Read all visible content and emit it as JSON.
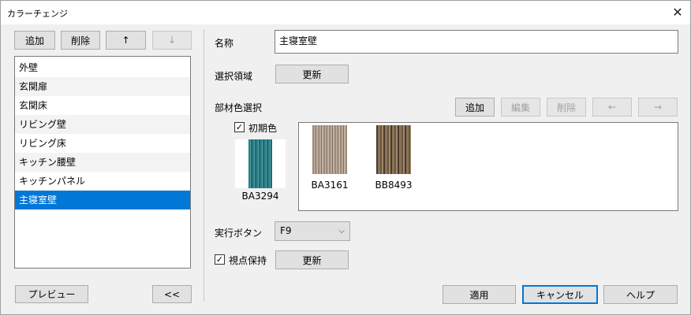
{
  "window": {
    "title": "カラーチェンジ",
    "close_glyph": "✕"
  },
  "toolbar": {
    "add": "追加",
    "delete": "削除",
    "up": "↑",
    "down": "↓"
  },
  "list": {
    "items": [
      "外壁",
      "玄関扉",
      "玄関床",
      "リビング壁",
      "リビング床",
      "キッチン腰壁",
      "キッチンパネル",
      "主寝室壁"
    ],
    "selected_index": 7
  },
  "footer_left": {
    "preview": "プレビュー",
    "collapse": "<<"
  },
  "form": {
    "name_label": "名称",
    "name_value": "主寝室壁",
    "region_label": "選択領域",
    "update_label": "更新",
    "material_label": "部材色選択",
    "mat_add": "追加",
    "mat_edit": "編集",
    "mat_delete": "削除",
    "mat_left": "←",
    "mat_right": "→",
    "initial_color_label": "初期色",
    "initial_color_checked": true,
    "initial_swatch": {
      "code": "BA3294",
      "texture": "teal"
    },
    "materials": [
      {
        "code": "BA3161",
        "texture": "stone"
      },
      {
        "code": "BB8493",
        "texture": "wood"
      }
    ],
    "exec_label": "実行ボタン",
    "exec_value": "F9",
    "keep_view_label": "視点保持",
    "keep_view_checked": true,
    "keep_update_label": "更新"
  },
  "actions": {
    "apply": "適用",
    "cancel": "キャンセル",
    "help": "ヘルプ"
  },
  "colors": {
    "accent": "#0078d7",
    "background": "#f0f0f0"
  }
}
